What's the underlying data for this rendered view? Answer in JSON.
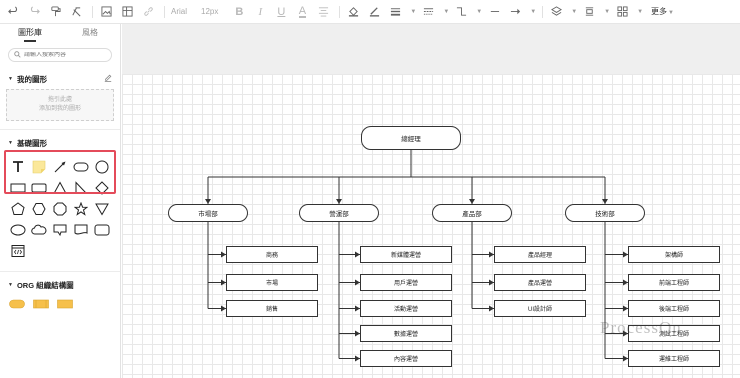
{
  "toolbar": {
    "font_name": "Arial",
    "font_size": "12px",
    "more_label": "更多"
  },
  "sidebar": {
    "tabs": [
      {
        "label": "圖形庫",
        "active": true
      },
      {
        "label": "風格",
        "active": false
      }
    ],
    "search_placeholder": "請輸入搜索內容",
    "my_shapes": {
      "title": "我的圖形",
      "drop_hint_1": "拖引此處",
      "drop_hint_2": "添加到我的圖形"
    },
    "basic_shapes": {
      "title": "基礎圖形"
    },
    "org_shapes": {
      "title": "ORG 組織結構圖"
    }
  },
  "org_chart": {
    "root": "總經理",
    "departments": [
      {
        "name": "市場部",
        "children": [
          "商務",
          "市場",
          "銷售"
        ]
      },
      {
        "name": "營運部",
        "children": [
          "新媒體運營",
          "用戶運營",
          "活動運營",
          "數據運營",
          "內容運營"
        ]
      },
      {
        "name": "產品部",
        "children": [
          "產品經理",
          "產品運營",
          "UI設計師"
        ]
      },
      {
        "name": "技術部",
        "children": [
          "架構師",
          "前端工程師",
          "後端工程師",
          "測試工程師",
          "運維工程師"
        ]
      }
    ]
  },
  "watermark": "ProcessOn",
  "colors": {
    "highlight": "#e44b5a",
    "node_border": "#333333",
    "grid": "#e8e8e8"
  }
}
